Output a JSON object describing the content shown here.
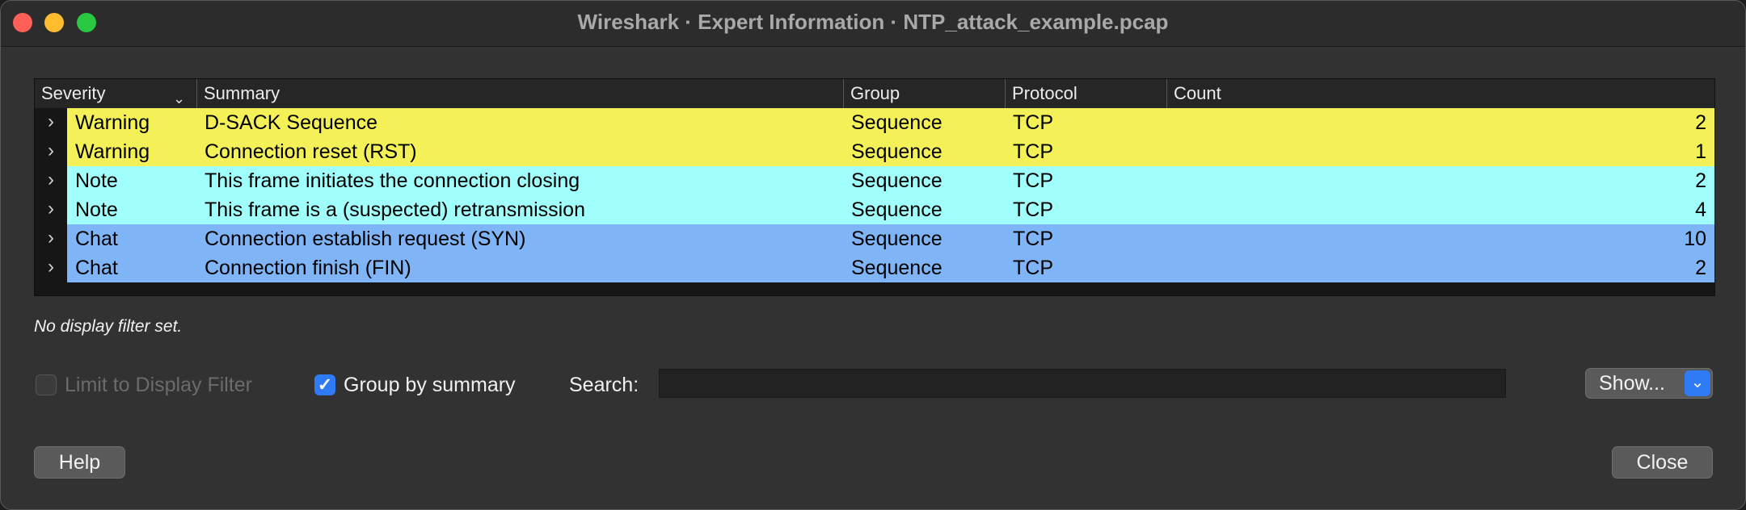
{
  "window": {
    "title": "Wireshark · Expert Information · NTP_attack_example.pcap"
  },
  "table": {
    "columns": [
      "Severity",
      "Summary",
      "Group",
      "Protocol",
      "Count"
    ],
    "sort_indicator": "chevron-down-icon",
    "rows": [
      {
        "severity": "Warning",
        "summary": "D-SACK Sequence",
        "group": "Sequence",
        "protocol": "TCP",
        "count": "2",
        "color": "#f4f158"
      },
      {
        "severity": "Warning",
        "summary": "Connection reset (RST)",
        "group": "Sequence",
        "protocol": "TCP",
        "count": "1",
        "color": "#f4f158"
      },
      {
        "severity": "Note",
        "summary": "This frame initiates the connection closing",
        "group": "Sequence",
        "protocol": "TCP",
        "count": "2",
        "color": "#a0fffb"
      },
      {
        "severity": "Note",
        "summary": "This frame is a (suspected) retransmission",
        "group": "Sequence",
        "protocol": "TCP",
        "count": "4",
        "color": "#a0fffb"
      },
      {
        "severity": "Chat",
        "summary": "Connection establish request (SYN)",
        "group": "Sequence",
        "protocol": "TCP",
        "count": "10",
        "color": "#7fb4f6"
      },
      {
        "severity": "Chat",
        "summary": "Connection finish (FIN)",
        "group": "Sequence",
        "protocol": "TCP",
        "count": "2",
        "color": "#7fb4f6"
      }
    ]
  },
  "status": "No display filter set.",
  "options": {
    "limit_label": "Limit to Display Filter",
    "limit_checked": false,
    "group_label": "Group by summary",
    "group_checked": true
  },
  "search": {
    "label": "Search:",
    "value": ""
  },
  "buttons": {
    "show": "Show...",
    "help": "Help",
    "close": "Close"
  }
}
